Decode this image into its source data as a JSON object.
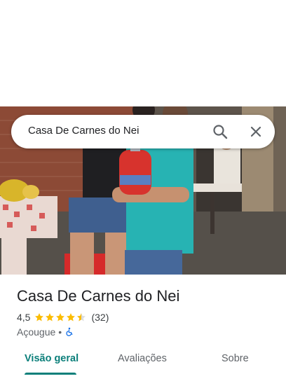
{
  "search": {
    "query": "Casa De Carnes do Nei"
  },
  "icons": {
    "search": "search-icon",
    "close": "close-icon",
    "accessible": "wheelchair-icon",
    "star": "star-icon"
  },
  "place": {
    "name": "Casa De Carnes do Nei",
    "rating": "4,5",
    "stars": 4.5,
    "review_count": "(32)",
    "category": "Açougue",
    "separator": "•",
    "wheelchair_accessible": true
  },
  "tabs": [
    {
      "label": "Visão geral",
      "active": true
    },
    {
      "label": "Avaliações",
      "active": false
    },
    {
      "label": "Sobre",
      "active": false
    }
  ],
  "colors": {
    "accent": "#0b7f7a",
    "star": "#fbbc04",
    "accessible": "#1a73e8"
  }
}
